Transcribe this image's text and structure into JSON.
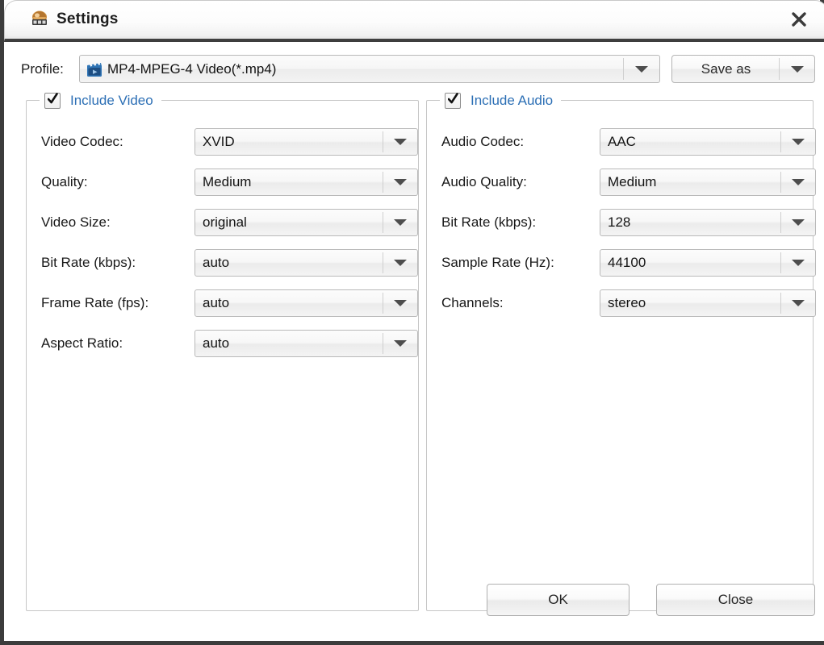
{
  "window": {
    "title": "Settings",
    "app_icon": "app-settings-icon",
    "close_icon": "close-icon"
  },
  "profile": {
    "label": "Profile:",
    "value": "MP4-MPEG-4 Video(*.mp4)",
    "file_icon": "video-file-icon",
    "dropdown_icon": "chevron-down-icon",
    "save_as_label": "Save as",
    "save_as_dropdown_icon": "chevron-down-icon"
  },
  "video": {
    "checkbox_checked": true,
    "title": "Include Video",
    "title_color": "#2c6fb5",
    "rows": [
      {
        "label": "Video Codec:",
        "value": "XVID"
      },
      {
        "label": "Quality:",
        "value": "Medium"
      },
      {
        "label": "Video Size:",
        "value": "original"
      },
      {
        "label": "Bit Rate (kbps):",
        "value": "auto"
      },
      {
        "label": "Frame Rate (fps):",
        "value": "auto"
      },
      {
        "label": "Aspect Ratio:",
        "value": "auto"
      }
    ]
  },
  "audio": {
    "checkbox_checked": true,
    "title": "Include Audio",
    "title_color": "#2c6fb5",
    "rows": [
      {
        "label": "Audio Codec:",
        "value": "AAC"
      },
      {
        "label": "Audio Quality:",
        "value": "Medium"
      },
      {
        "label": "Bit Rate (kbps):",
        "value": "128"
      },
      {
        "label": "Sample Rate (Hz):",
        "value": "44100"
      },
      {
        "label": "Channels:",
        "value": "stereo"
      }
    ]
  },
  "footer": {
    "ok_label": "OK",
    "close_label": "Close"
  }
}
